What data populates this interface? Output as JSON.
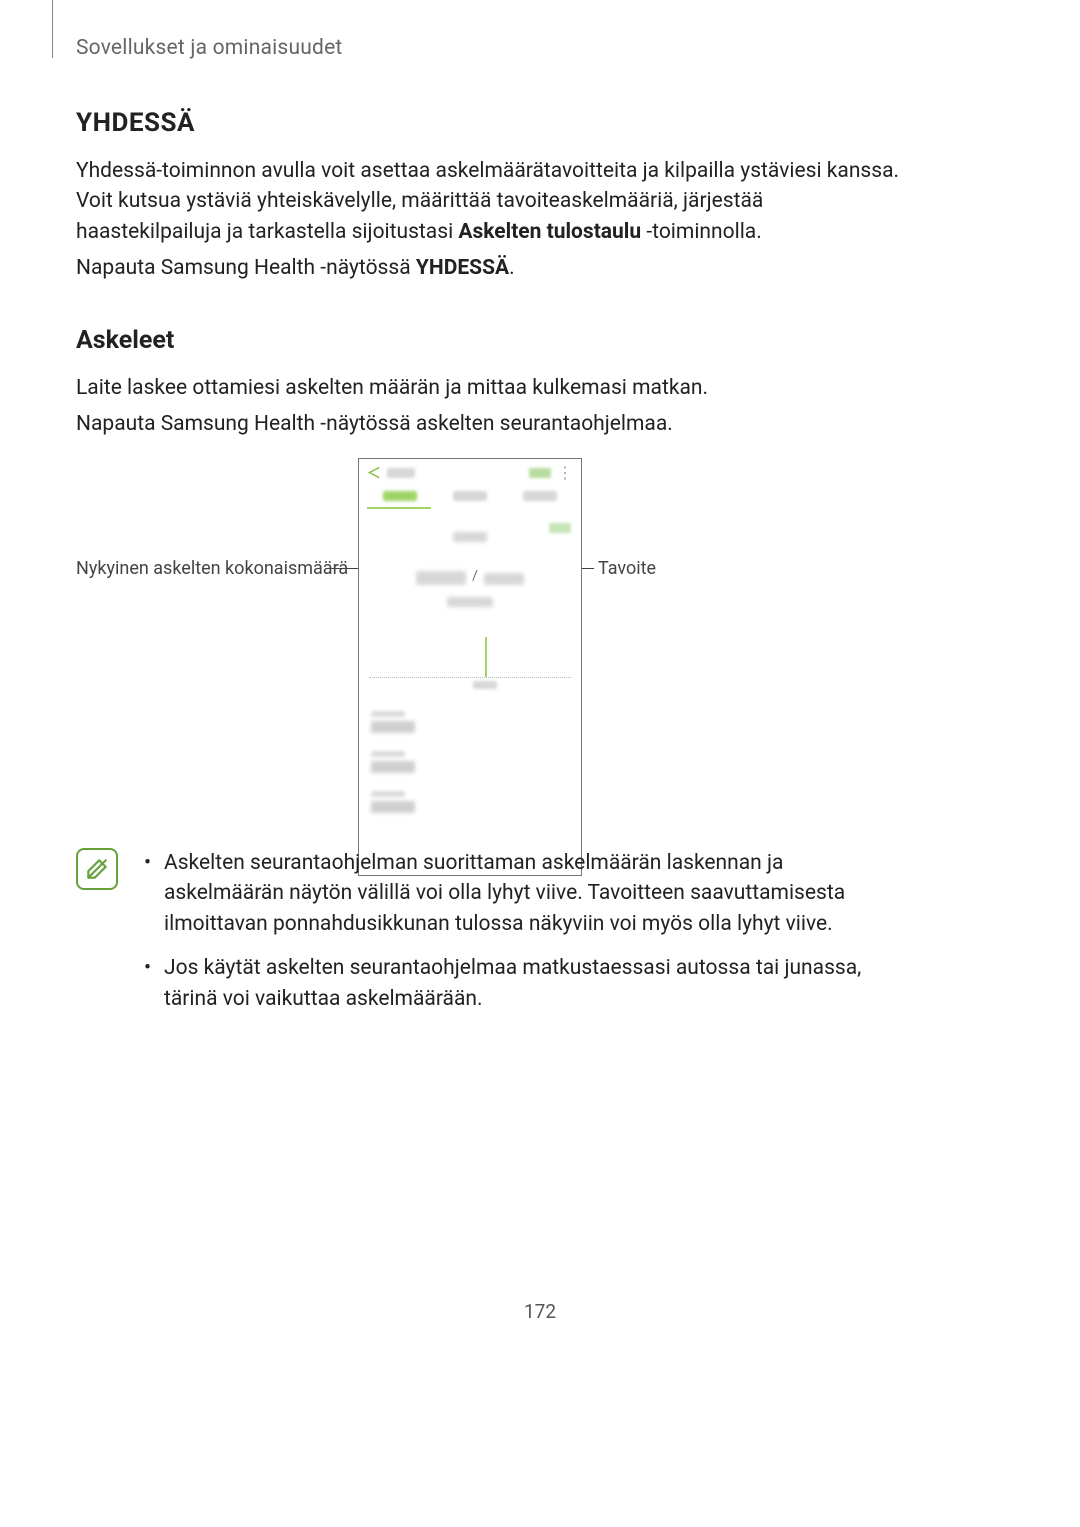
{
  "header": {
    "breadcrumb": "Sovellukset ja ominaisuudet"
  },
  "section1": {
    "title": "YHDESSÄ",
    "para1_prefix": "Yhdessä-toiminnon avulla voit asettaa askelmäärätavoitteita ja kilpailla ystäviesi kanssa. Voit kutsua ystäviä yhteiskävelylle, määrittää tavoiteaskelmääriä, järjestää haastekilpailuja ja tarkastella sijoitustasi ",
    "para1_bold": "Askelten tulostaulu",
    "para1_suffix": " -toiminnolla.",
    "para2_prefix": "Napauta Samsung Health -näytössä ",
    "para2_bold": "YHDESSÄ",
    "para2_suffix": "."
  },
  "section2": {
    "title": "Askeleet",
    "para1": "Laite laskee ottamiesi askelten määrän ja mittaa kulkemasi matkan.",
    "para2": "Napauta Samsung Health -näytössä askelten seurantaohjelmaa."
  },
  "diagram": {
    "left_callout": "Nykyinen askelten kokonaismäärä",
    "right_callout": "Tavoite"
  },
  "notes": {
    "bullet1": "Askelten seurantaohjelman suorittaman askelmäärän laskennan ja askelmäärän näytön välillä voi olla lyhyt viive. Tavoitteen saavuttamisesta ilmoittavan ponnahdusikkunan tulossa näkyviin voi myös olla lyhyt viive.",
    "bullet2": "Jos käytät askelten seurantaohjelmaa matkustaessasi autossa tai junassa, tärinä voi vaikuttaa askelmäärään."
  },
  "page_number": "172"
}
